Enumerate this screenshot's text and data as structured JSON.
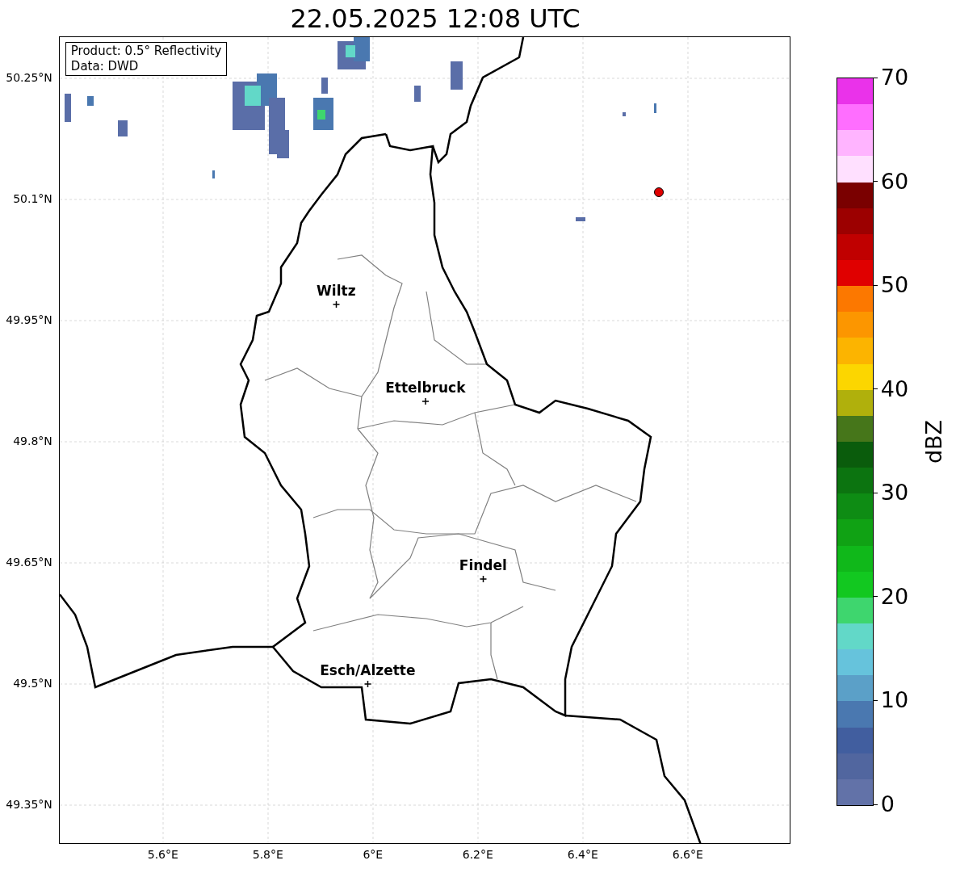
{
  "title": "22.05.2025 12:08 UTC",
  "info_box": [
    "Product: 0.5° Reflectivity",
    "Data: DWD"
  ],
  "cities": [
    {
      "name": "Wiltz"
    },
    {
      "name": "Ettelbruck"
    },
    {
      "name": "Findel"
    },
    {
      "name": "Esch/Alzette"
    }
  ],
  "lat_ticks": [
    "50.25°N",
    "50.1°N",
    "49.95°N",
    "49.8°N",
    "49.65°N",
    "49.5°N",
    "49.35°N"
  ],
  "lon_ticks": [
    "5.6°E",
    "5.8°E",
    "6°E",
    "6.2°E",
    "6.4°E",
    "6.6°E"
  ],
  "colorbar": {
    "label": "dBZ",
    "ticks": [
      "70",
      "60",
      "50",
      "40",
      "30",
      "20",
      "10",
      "0"
    ],
    "bins": [
      {
        "color": "#ea32ea"
      },
      {
        "color": "#ff6eff"
      },
      {
        "color": "#ffb4ff"
      },
      {
        "color": "#ffe0ff"
      },
      {
        "color": "#7a0000"
      },
      {
        "color": "#9c0000"
      },
      {
        "color": "#c00000"
      },
      {
        "color": "#e00000"
      },
      {
        "color": "#fc7800"
      },
      {
        "color": "#fc9600"
      },
      {
        "color": "#fcb400"
      },
      {
        "color": "#fcd600"
      },
      {
        "color": "#b0b00c"
      },
      {
        "color": "#46761a"
      },
      {
        "color": "#0a5c0c"
      },
      {
        "color": "#0c7410"
      },
      {
        "color": "#0e8c14"
      },
      {
        "color": "#10a214"
      },
      {
        "color": "#10b81a"
      },
      {
        "color": "#12c820"
      },
      {
        "color": "#3ed66e"
      },
      {
        "color": "#62d8c8"
      },
      {
        "color": "#66c3dc"
      },
      {
        "color": "#5ba0c8"
      },
      {
        "color": "#4a78b0"
      },
      {
        "color": "#415e9f"
      },
      {
        "color": "#51669f"
      },
      {
        "color": "#6272a8"
      }
    ]
  }
}
